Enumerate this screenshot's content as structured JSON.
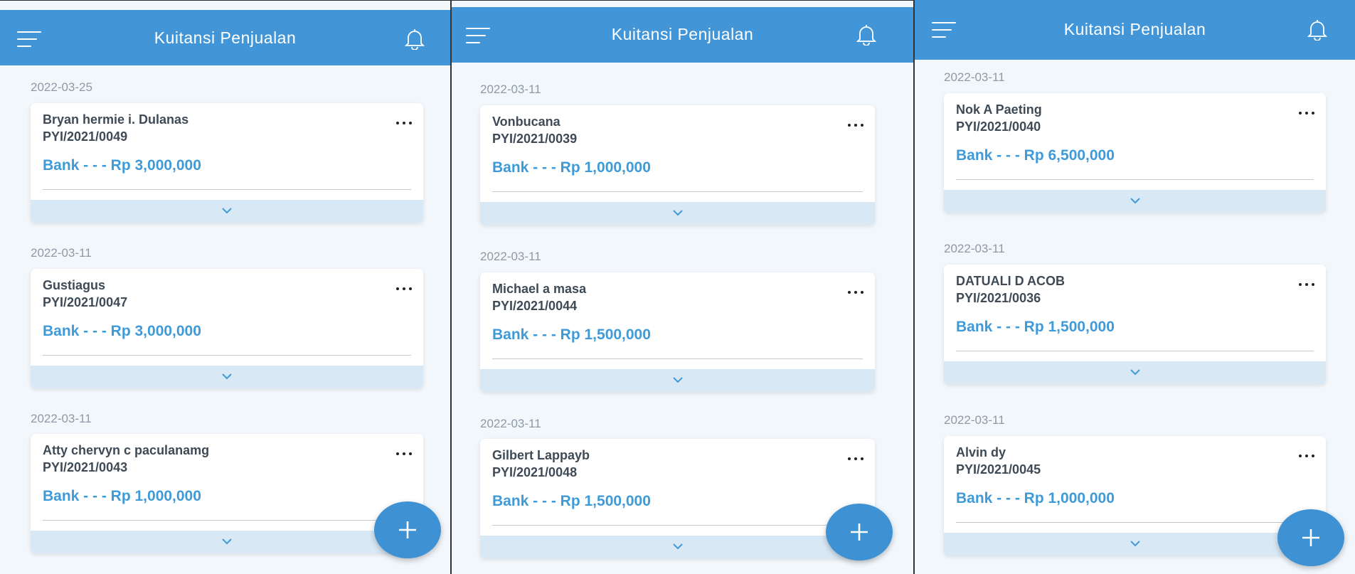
{
  "colors": {
    "appbar": "#4296d7",
    "amount": "#3f9ad8",
    "background": "#f2f7fb",
    "expand_bar": "#d8e8f5",
    "fab": "#3e92d4"
  },
  "icons": {
    "menu": "hamburger-menu-icon",
    "notification": "bell-icon",
    "more": "more-horizontal-icon",
    "expand": "chevron-down-icon",
    "add": "plus-icon"
  },
  "panels": [
    {
      "title": "Kuitansi Penjualan",
      "items": [
        {
          "date": "2022-03-25",
          "name": "Bryan hermie i. Dulanas",
          "code": "PYI/2021/0049",
          "amount": "Bank - - - Rp 3,000,000"
        },
        {
          "date": "2022-03-11",
          "name": "Gustiagus",
          "code": "PYI/2021/0047",
          "amount": "Bank - - - Rp 3,000,000"
        },
        {
          "date": "2022-03-11",
          "name": "Atty chervyn c paculanamg",
          "code": "PYI/2021/0043",
          "amount": "Bank - - - Rp 1,000,000"
        }
      ]
    },
    {
      "title": "Kuitansi Penjualan",
      "items": [
        {
          "date": "2022-03-11",
          "name": "Vonbucana",
          "code": "PYI/2021/0039",
          "amount": "Bank - - - Rp 1,000,000"
        },
        {
          "date": "2022-03-11",
          "name": "Michael a masa",
          "code": "PYI/2021/0044",
          "amount": "Bank - - - Rp 1,500,000"
        },
        {
          "date": "2022-03-11",
          "name": "Gilbert Lappayb",
          "code": "PYI/2021/0048",
          "amount": "Bank - - - Rp 1,500,000"
        }
      ]
    },
    {
      "title": "Kuitansi Penjualan",
      "items": [
        {
          "date": "2022-03-11",
          "name": "Nok A Paeting",
          "code": "PYI/2021/0040",
          "amount": "Bank - - - Rp 6,500,000"
        },
        {
          "date": "2022-03-11",
          "name": "DATUALI D ACOB",
          "code": "PYI/2021/0036",
          "amount": "Bank - - - Rp 1,500,000"
        },
        {
          "date": "2022-03-11",
          "name": "Alvin dy",
          "code": "PYI/2021/0045",
          "amount": "Bank - - - Rp 1,000,000"
        }
      ]
    }
  ]
}
